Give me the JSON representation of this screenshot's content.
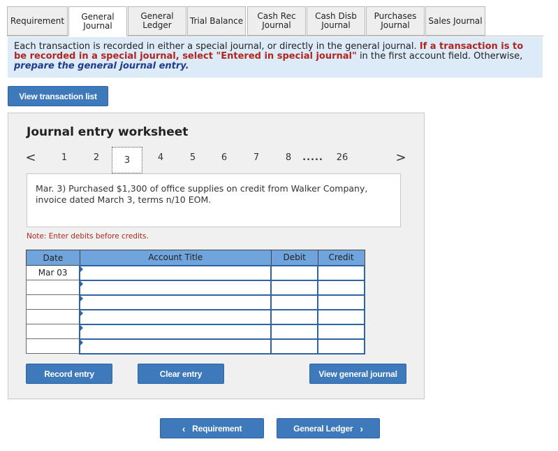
{
  "tabs": [
    {
      "label": "Requirement"
    },
    {
      "label": "General\nJournal"
    },
    {
      "label": "General\nLedger"
    },
    {
      "label": "Trial Balance"
    },
    {
      "label": "Cash Rec\nJournal"
    },
    {
      "label": "Cash Disb\nJournal"
    },
    {
      "label": "Purchases\nJournal"
    },
    {
      "label": "Sales Journal"
    }
  ],
  "instructions": {
    "part1": "Each transaction is recorded in either a special journal, or directly in the general journal.",
    "part2": "If a transaction is to be recorded in a special journal, select \"Entered in special journal\"",
    "part3": "in the first account field.  Otherwise,",
    "part4": "prepare the general journal entry."
  },
  "view_transaction_label": "View transaction list",
  "worksheet": {
    "title": "Journal entry worksheet",
    "pager": {
      "prev": "<",
      "pages": [
        "1",
        "2",
        "3",
        "4",
        "5",
        "6",
        "7",
        "8"
      ],
      "ellipsis": ".....",
      "last": "26",
      "next": ">",
      "active_page": "3"
    },
    "description": "Mar. 3) Purchased $1,300 of office supplies on credit from Walker Company, invoice dated March 3, terms n/10 EOM.",
    "note": "Note: Enter debits before credits.",
    "table": {
      "headers": [
        "Date",
        "Account Title",
        "Debit",
        "Credit"
      ],
      "rows": [
        {
          "date": "Mar 03",
          "account": "",
          "debit": "",
          "credit": ""
        },
        {
          "date": "",
          "account": "",
          "debit": "",
          "credit": ""
        },
        {
          "date": "",
          "account": "",
          "debit": "",
          "credit": ""
        },
        {
          "date": "",
          "account": "",
          "debit": "",
          "credit": ""
        },
        {
          "date": "",
          "account": "",
          "debit": "",
          "credit": ""
        },
        {
          "date": "",
          "account": "",
          "debit": "",
          "credit": ""
        }
      ]
    },
    "record_entry_label": "Record entry",
    "clear_entry_label": "Clear entry",
    "view_general_journal_label": "View general journal"
  },
  "nav": {
    "prev_label": "Requirement",
    "next_label": "General Ledger"
  },
  "colors": {
    "button": "#3e79bc",
    "table_header": "#6fa4dc",
    "instructions_bg": "#dcebf7",
    "warning": "#b0261f"
  }
}
